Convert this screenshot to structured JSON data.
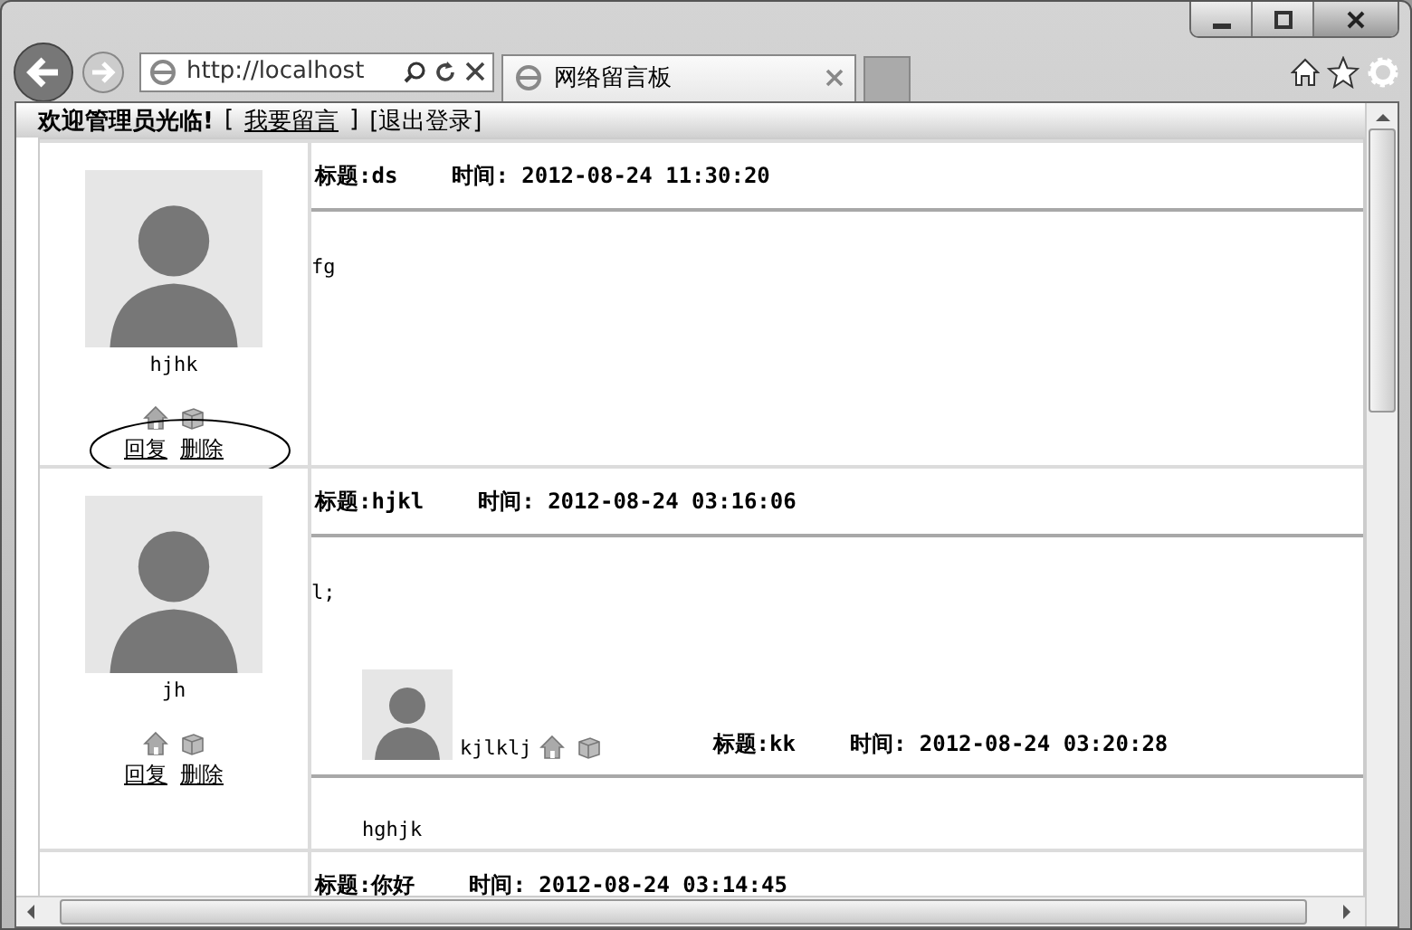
{
  "browser": {
    "address": "http://localhost",
    "tab_title": "网络留言板"
  },
  "header": {
    "welcome": "欢迎管理员光临!",
    "parts": [
      {
        "kind": "text",
        "text": "["
      },
      {
        "kind": "link",
        "text": "我要留言"
      },
      {
        "kind": "text",
        "text": "]"
      },
      {
        "kind": "text",
        "text": "[退出登录]"
      }
    ]
  },
  "posts": [
    {
      "author": "hjhk",
      "title": "标题:ds",
      "time": "时间: 2012-08-24 11:30:20",
      "body": "fg",
      "actions": [
        "回复",
        "删除"
      ],
      "circled": true
    },
    {
      "author": "jh",
      "title": "标题:hjkl",
      "time": "时间: 2012-08-24 03:16:06",
      "body": "l;",
      "actions": [
        "回复",
        "删除"
      ],
      "circled": false,
      "replies": [
        {
          "author": "kjlklj",
          "title": "标题:kk",
          "time": "时间: 2012-08-24 03:20:28",
          "body": "hghjk"
        }
      ]
    },
    {
      "title": "标题:你好",
      "time": "时间: 2012-08-24 03:14:45",
      "circled": false
    }
  ]
}
